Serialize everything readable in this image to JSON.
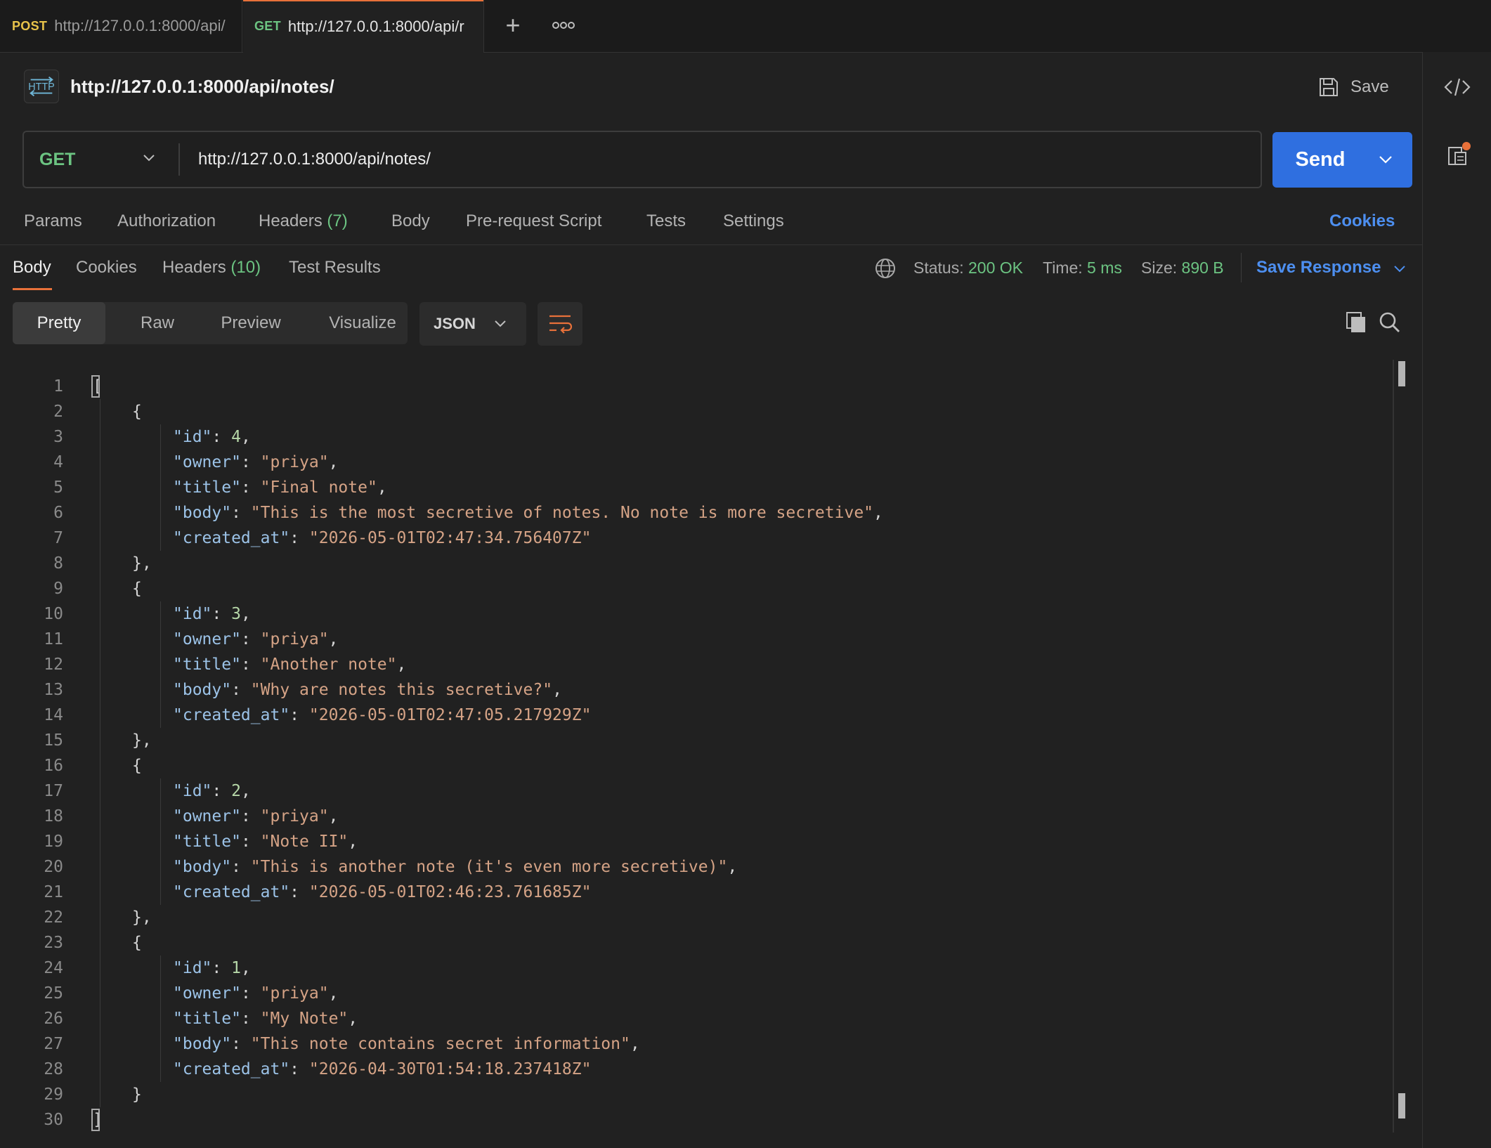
{
  "tabs": [
    {
      "method": "POST",
      "url": "http://127.0.0.1:8000/api/"
    },
    {
      "method": "GET",
      "url": "http://127.0.0.1:8000/api/r"
    }
  ],
  "request": {
    "name": "http://127.0.0.1:8000/api/notes/",
    "save_label": "Save",
    "method": "GET",
    "url": "http://127.0.0.1:8000/api/notes/",
    "send_label": "Send",
    "tabs": {
      "params": "Params",
      "authorization": "Authorization",
      "headers": "Headers",
      "headers_count": "(7)",
      "body": "Body",
      "prerequest": "Pre-request Script",
      "tests": "Tests",
      "settings": "Settings"
    },
    "cookies_link": "Cookies"
  },
  "response": {
    "tabs": {
      "body": "Body",
      "cookies": "Cookies",
      "headers": "Headers",
      "headers_count": "(10)",
      "test_results": "Test Results"
    },
    "status_label": "Status:",
    "status_value": "200 OK",
    "time_label": "Time:",
    "time_value": "5 ms",
    "size_label": "Size:",
    "size_value": "890 B",
    "save_response": "Save Response",
    "view_modes": [
      "Pretty",
      "Raw",
      "Preview",
      "Visualize"
    ],
    "format": "JSON",
    "notes": [
      {
        "id": "4",
        "owner": "\"priya\"",
        "title": "\"Final note\"",
        "body": "\"This is the most secretive of notes. No note is more secretive\"",
        "created_at": "\"2026-05-01T02:47:34.756407Z\""
      },
      {
        "id": "3",
        "owner": "\"priya\"",
        "title": "\"Another note\"",
        "body": "\"Why are notes this secretive?\"",
        "created_at": "\"2026-05-01T02:47:05.217929Z\""
      },
      {
        "id": "2",
        "owner": "\"priya\"",
        "title": "\"Note II\"",
        "body": "\"This is another note (it's even more secretive)\"",
        "created_at": "\"2026-05-01T02:46:23.761685Z\""
      },
      {
        "id": "1",
        "owner": "\"priya\"",
        "title": "\"My Note\"",
        "body": "\"This note contains secret information\"",
        "created_at": "\"2026-04-30T01:54:18.237418Z\""
      }
    ]
  },
  "icons": {
    "http": "http-icon",
    "save": "floppy-disk-icon",
    "code": "code-brackets-icon",
    "docs": "documentation-icon",
    "globe": "globe-icon",
    "copy": "copy-icon",
    "search": "search-icon",
    "wrap": "wrap-lines-icon"
  },
  "colors": {
    "accent": "#e8713a",
    "send": "#2f6fe0",
    "get": "#6cc482",
    "post": "#e8c34a",
    "json_key": "#9cc3e8",
    "json_string": "#d5a386",
    "json_number": "#b6d7a8"
  }
}
